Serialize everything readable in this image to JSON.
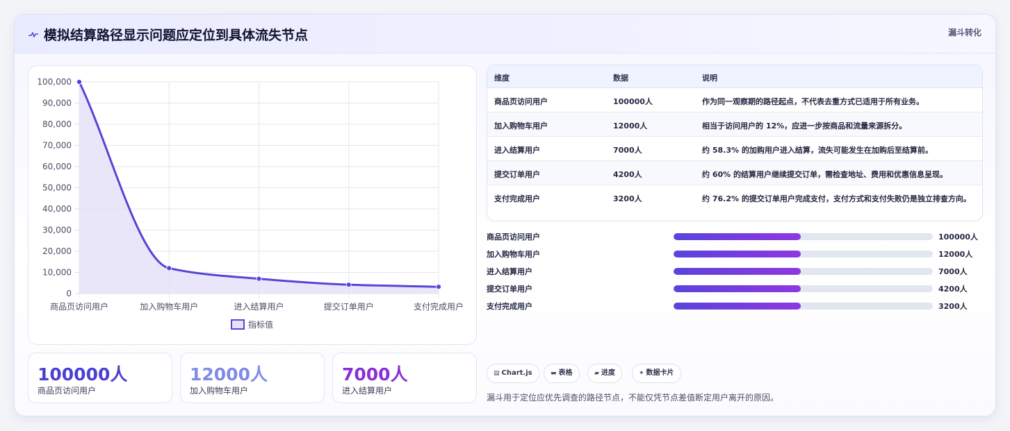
{
  "header": {
    "title": "模拟结算路径显示问题应定位到具体流失节点",
    "tag": "漏斗转化",
    "icon": "pulse-icon"
  },
  "colors": {
    "line": "#5446d6",
    "area_fill": "#e6e2f8",
    "bar_start": "#5b43db",
    "bar_end": "#8e38e0",
    "stat_1": "#4b3fd2",
    "stat_2": "#7f8be8",
    "stat_3": "#8a2fd6"
  },
  "chart_data": {
    "type": "line",
    "categories": [
      "商品页访问用户",
      "加入购物车用户",
      "进入结算用户",
      "提交订单用户",
      "支付完成用户"
    ],
    "series": [
      {
        "name": "指标值",
        "values": [
          100000,
          12000,
          7000,
          4200,
          3200
        ]
      }
    ],
    "ylim": [
      0,
      100000
    ],
    "yticks": [
      0,
      10000,
      20000,
      30000,
      40000,
      50000,
      60000,
      70000,
      80000,
      90000,
      100000
    ],
    "ytick_labels": [
      "0",
      "10,000",
      "20,000",
      "30,000",
      "40,000",
      "50,000",
      "60,000",
      "70,000",
      "80,000",
      "90,000",
      "100,000"
    ],
    "grid": true,
    "filled": true,
    "smooth": true,
    "legend_position": "bottom"
  },
  "stats": [
    {
      "value": "100000人",
      "label": "商品页访问用户"
    },
    {
      "value": "12000人",
      "label": "加入购物车用户"
    },
    {
      "value": "7000人",
      "label": "进入结算用户"
    }
  ],
  "table": {
    "headers": [
      "维度",
      "数据",
      "说明"
    ],
    "rows": [
      {
        "dim": "商品页访问用户",
        "value": "100000人",
        "desc": "作为同一观察期的路径起点，不代表去重方式已适用于所有业务。"
      },
      {
        "dim": "加入购物车用户",
        "value": "12000人",
        "desc": "相当于访问用户的 12%，应进一步按商品和流量来源拆分。"
      },
      {
        "dim": "进入结算用户",
        "value": "7000人",
        "desc": "约 58.3% 的加购用户进入结算，流失可能发生在加购后至结算前。"
      },
      {
        "dim": "提交订单用户",
        "value": "4200人",
        "desc": "约 60% 的结算用户继续提交订单，需检查地址、费用和优惠信息呈现。"
      },
      {
        "dim": "支付完成用户",
        "value": "3200人",
        "desc": "约 76.2% 的提交订单用户完成支付，支付方式和支付失败仍是独立排查方向。"
      }
    ]
  },
  "progress": [
    {
      "label": "商品页访问用户",
      "value": "100000人",
      "fraction": 0.49
    },
    {
      "label": "加入购物车用户",
      "value": "12000人",
      "fraction": 0.49
    },
    {
      "label": "进入结算用户",
      "value": "7000人",
      "fraction": 0.49
    },
    {
      "label": "提交订单用户",
      "value": "4200人",
      "fraction": 0.49
    },
    {
      "label": "支付完成用户",
      "value": "3200人",
      "fraction": 0.49
    }
  ],
  "chips": [
    {
      "label": "Chart.js",
      "icon": "chart-icon"
    },
    {
      "label": "表格",
      "icon": "table-icon"
    },
    {
      "label": "进度",
      "icon": "progress-icon"
    },
    {
      "label": "数据卡片",
      "icon": "sparkle-icon"
    }
  ],
  "footer": {
    "note": "漏斗用于定位应优先调查的路径节点，不能仅凭节点差值断定用户离开的原因。"
  }
}
